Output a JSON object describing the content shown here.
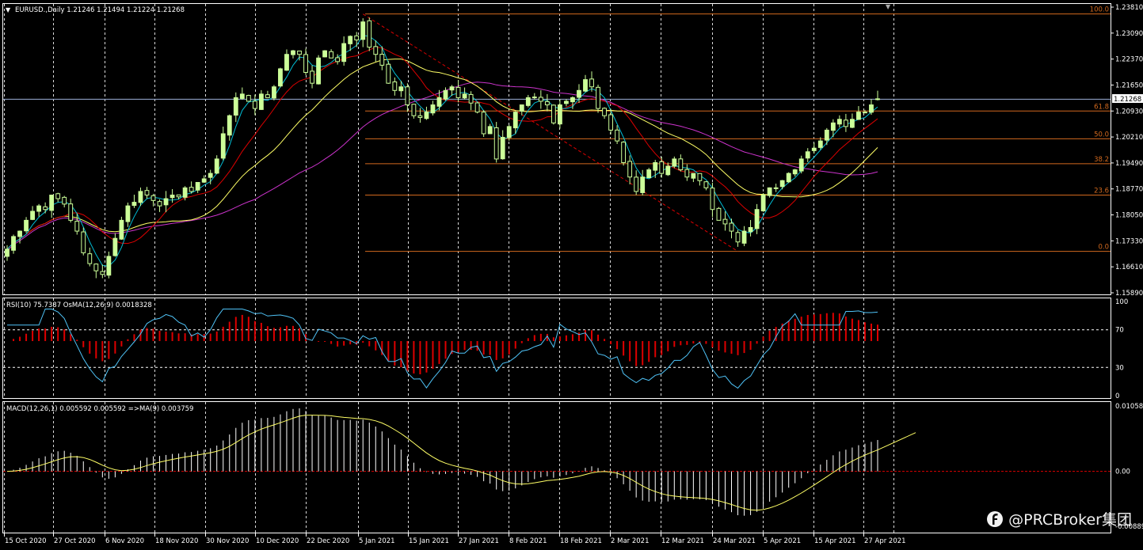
{
  "main": {
    "header": "EURUSD.,Daily  1.21246 1.21494 1.21224 1.21268",
    "price_tag": "1.21268",
    "fib_levels": [
      {
        "label": "100.0",
        "price": 1.2362
      },
      {
        "label": "61.8",
        "price": 1.2093
      },
      {
        "label": "50.0",
        "price": 1.2016
      },
      {
        "label": "38.2",
        "price": 1.1947
      },
      {
        "label": "23.6",
        "price": 1.186
      },
      {
        "label": "0.0",
        "price": 1.1704
      }
    ],
    "y_ticks": [
      "1.23810",
      "1.23090",
      "1.22370",
      "1.21650",
      "1.20930",
      "1.20210",
      "1.19490",
      "1.18770",
      "1.18050",
      "1.17330",
      "1.16610",
      "1.15890"
    ]
  },
  "rsi": {
    "header": "RSI(10) 75.7387  OsMA(12,26,9) 0.0018328",
    "y_ticks": [
      "100",
      "70",
      "30",
      "0"
    ]
  },
  "macd": {
    "header": "MACD(12,26,1) 0.005592 0.005592  =>MA(9) 0.003759",
    "y_ticks": [
      "0.010589",
      "0.00",
      "-0.00889"
    ]
  },
  "x_axis": {
    "labels": [
      "15 Oct 2020",
      "27 Oct 2020",
      "6 Nov 2020",
      "18 Nov 2020",
      "30 Nov 2020",
      "10 Dec 2020",
      "22 Dec 2020",
      "5 Jan 2021",
      "15 Jan 2021",
      "27 Jan 2021",
      "8 Feb 2021",
      "18 Feb 2021",
      "2 Mar 2021",
      "12 Mar 2021",
      "24 Mar 2021",
      "5 Apr 2021",
      "15 Apr 2021",
      "27 Apr 2021"
    ]
  },
  "watermark": "@PRCBroker集团",
  "colors": {
    "bull": "#ccff99",
    "bear": "#000000",
    "ma_fast": "#00bcd4",
    "ma_mid": "#dd0000",
    "ma_slow": "#ffff66",
    "ma_long": "#cc33cc",
    "fib": "#d2691e",
    "rsi_line": "#4fc3f7",
    "osma": "#dd0000",
    "macd_hist": "#ffffff",
    "macd_signal": "#ffff66",
    "grid": "#ffffff"
  },
  "chart_data": {
    "type": "candlestick",
    "symbol": "EURUSD.",
    "timeframe": "Daily",
    "last_ohlc": {
      "open": 1.21246,
      "high": 1.21494,
      "low": 1.21224,
      "close": 1.21268
    },
    "price_range": [
      1.1589,
      1.2381
    ],
    "closes": [
      1.171,
      1.1745,
      1.176,
      1.179,
      1.1815,
      1.183,
      1.182,
      1.186,
      1.185,
      1.1835,
      1.179,
      1.176,
      1.17,
      1.167,
      1.165,
      1.164,
      1.169,
      1.174,
      1.179,
      1.183,
      1.184,
      1.187,
      1.186,
      1.1845,
      1.183,
      1.185,
      1.186,
      1.1855,
      1.188,
      1.187,
      1.1895,
      1.1905,
      1.192,
      1.196,
      1.203,
      1.208,
      1.213,
      1.214,
      1.212,
      1.21,
      1.214,
      1.213,
      1.216,
      1.221,
      1.225,
      1.226,
      1.225,
      1.22,
      1.217,
      1.224,
      1.226,
      1.224,
      1.223,
      1.228,
      1.23,
      1.229,
      1.234,
      1.227,
      1.225,
      1.222,
      1.217,
      1.215,
      1.216,
      1.211,
      1.208,
      1.2075,
      1.209,
      1.211,
      1.213,
      1.215,
      1.216,
      1.213,
      1.214,
      1.2115,
      1.209,
      1.203,
      1.205,
      1.196,
      1.202,
      1.205,
      1.209,
      1.211,
      1.213,
      1.213,
      1.212,
      1.211,
      1.206,
      1.211,
      1.212,
      1.213,
      1.215,
      1.218,
      1.216,
      1.21,
      1.208,
      1.204,
      1.201,
      1.195,
      1.191,
      1.187,
      1.191,
      1.193,
      1.195,
      1.192,
      1.194,
      1.196,
      1.193,
      1.191,
      1.192,
      1.19,
      1.188,
      1.182,
      1.179,
      1.178,
      1.176,
      1.173,
      1.176,
      1.177,
      1.182,
      1.186,
      1.188,
      1.188,
      1.19,
      1.192,
      1.193,
      1.196,
      1.198,
      1.199,
      1.201,
      1.204,
      1.206,
      1.207,
      1.205,
      1.207,
      1.209,
      1.209,
      1.211,
      1.2127
    ]
  }
}
